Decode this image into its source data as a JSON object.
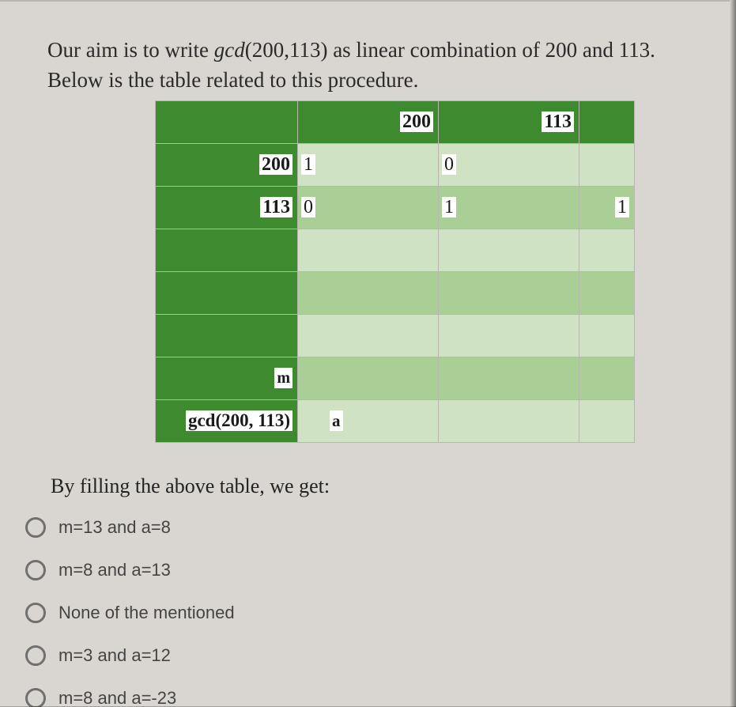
{
  "intro": {
    "pre": "Our aim is to write ",
    "gcd": "gcd",
    "args": "(200,113)",
    "post": " as linear combination of 200 and 113. Below is the table related to this procedure."
  },
  "table": {
    "header": {
      "c1": "200",
      "c2": "113"
    },
    "rows": [
      {
        "label": "200",
        "c1": "1",
        "c2": "0",
        "c3": ""
      },
      {
        "label": "113",
        "c1": "0",
        "c2": "1",
        "c3": "1"
      },
      {
        "label": "",
        "c1": "",
        "c2": "",
        "c3": ""
      },
      {
        "label": "",
        "c1": "",
        "c2": "",
        "c3": ""
      },
      {
        "label": "",
        "c1": "",
        "c2": "",
        "c3": ""
      },
      {
        "label": "m",
        "c1": "",
        "c2": "",
        "c3": ""
      },
      {
        "label": "gcd(200, 113)",
        "c1": "a",
        "c2": "",
        "c3": ""
      }
    ]
  },
  "followup": "By filling the above table, we get:",
  "options": [
    "m=13 and a=8",
    "m=8 and a=13",
    "None of the mentioned",
    "m=3 and a=12",
    "m=8 and a=-23"
  ]
}
